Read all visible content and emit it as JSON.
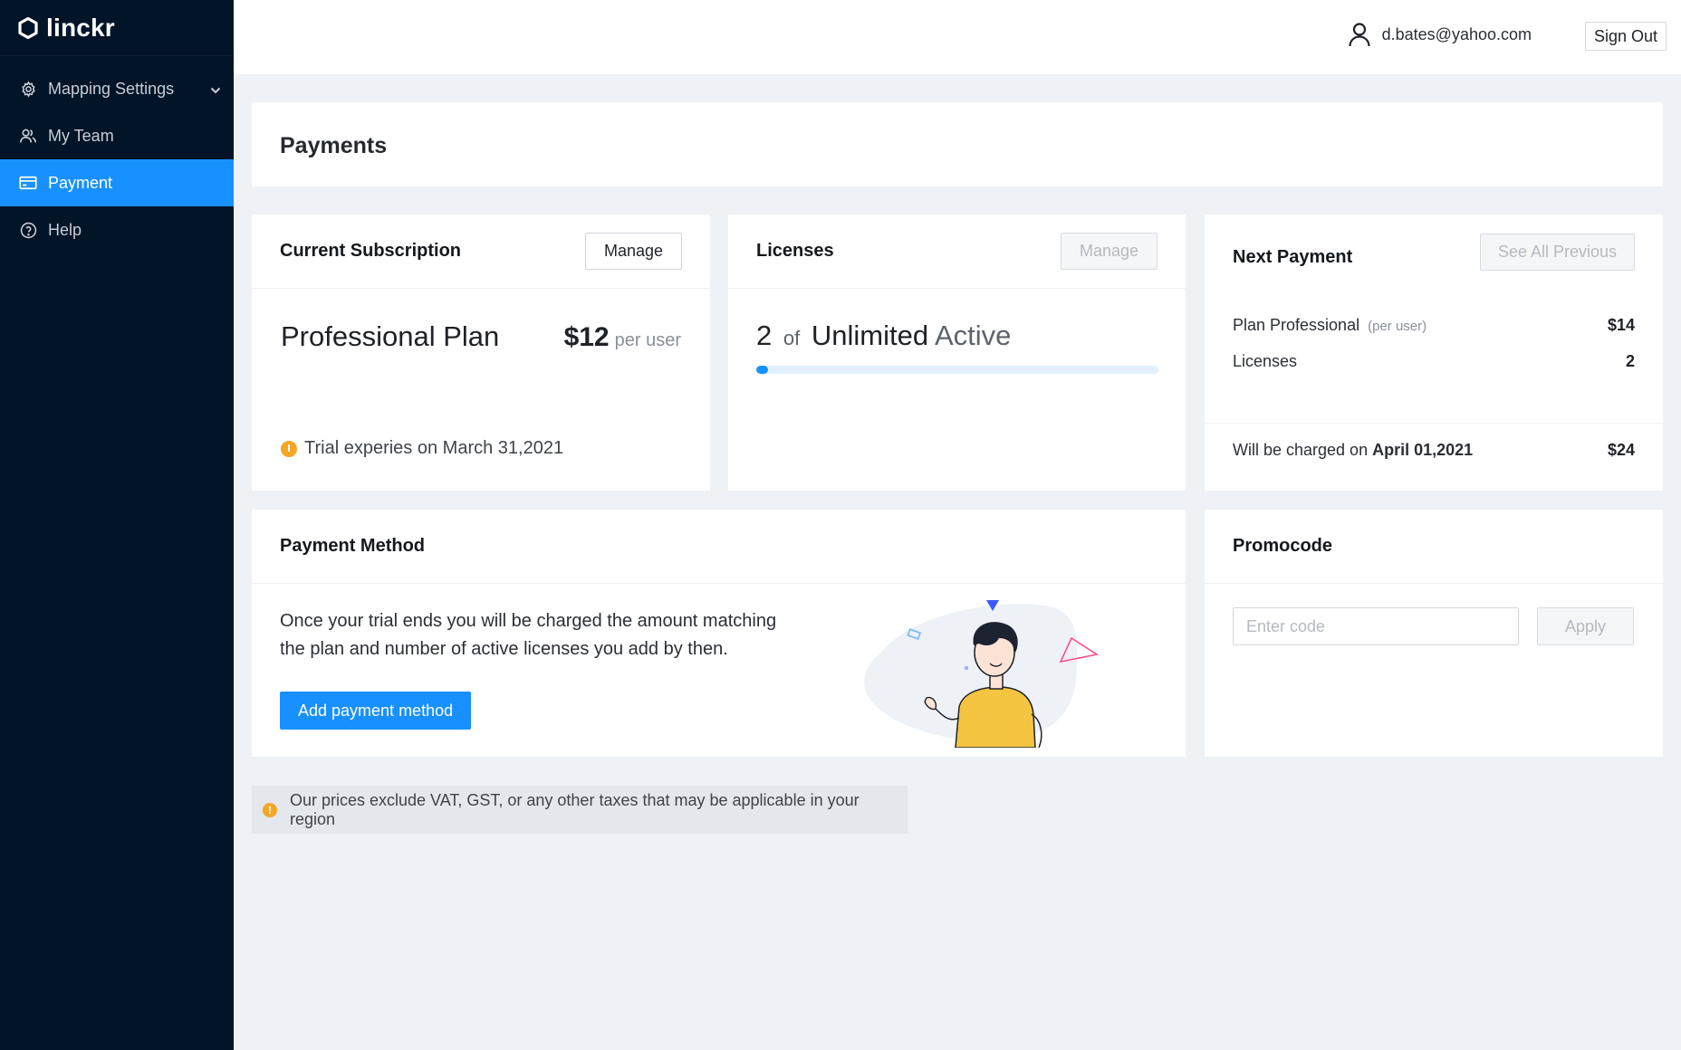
{
  "brand": {
    "name": "linckr"
  },
  "sidebar": {
    "items": [
      {
        "label": "Mapping Settings",
        "icon": "gear-icon",
        "has_submenu": true
      },
      {
        "label": "My Team",
        "icon": "team-icon"
      },
      {
        "label": "Payment",
        "icon": "credit-card-icon",
        "active": true
      },
      {
        "label": "Help",
        "icon": "help-icon"
      }
    ]
  },
  "header": {
    "user_email": "d.bates@yahoo.com",
    "signout_label": "Sign Out"
  },
  "page": {
    "title": "Payments"
  },
  "subscription": {
    "title": "Current Subscription",
    "manage_label": "Manage",
    "plan_name": "Professional Plan",
    "price": "$12",
    "price_unit": "per user",
    "trial_text": "Trial experies on March 31,2021"
  },
  "licenses": {
    "title": "Licenses",
    "manage_label": "Manage",
    "count": "2",
    "of_label": "of",
    "limit": "Unlimited",
    "status": "Active",
    "progress_fraction": 0.03
  },
  "next_payment": {
    "title": "Next Payment",
    "see_all_label": "See All Previous",
    "plan_label": "Plan Professional",
    "plan_unit": "(per user)",
    "plan_value": "$14",
    "licenses_label": "Licenses",
    "licenses_value": "2",
    "charge_prefix": "Will be charged on",
    "charge_date": "April 01,2021",
    "charge_value": "$24"
  },
  "payment_method": {
    "title": "Payment Method",
    "line1": "Once your trial ends you will be charged the amount matching",
    "line2": "the plan and number of active licenses you add by then.",
    "add_label": "Add payment method"
  },
  "promocode": {
    "title": "Promocode",
    "placeholder": "Enter code",
    "apply_label": "Apply"
  },
  "notice": {
    "text": "Our prices exclude VAT, GST, or any other taxes that may be applicable in your region"
  },
  "colors": {
    "accent": "#1890ff",
    "sidebar": "#011428",
    "warning": "#f5a623"
  }
}
